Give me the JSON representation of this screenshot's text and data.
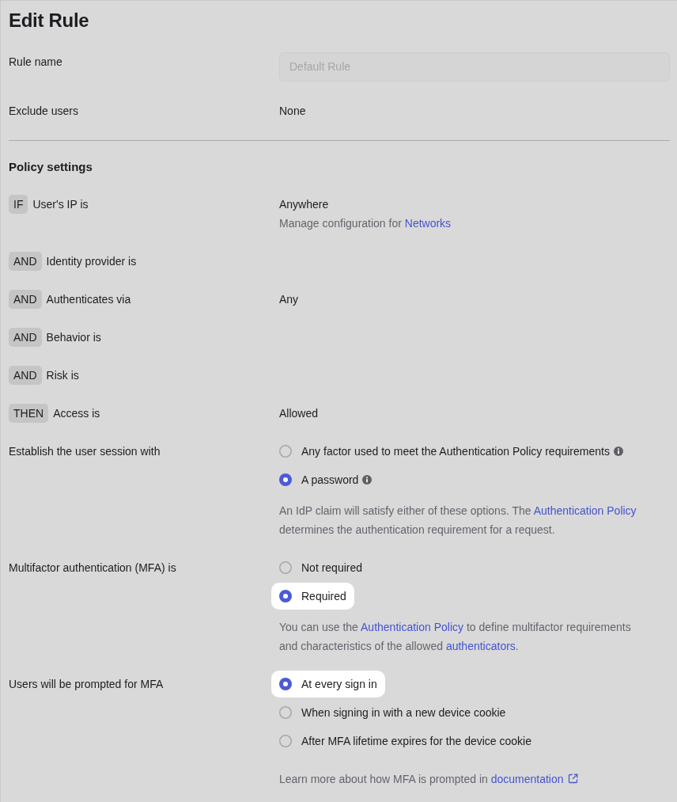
{
  "title": "Edit Rule",
  "fields": [
    {
      "label": "Rule name",
      "kind": "input",
      "value": "Default Rule",
      "disabled": true
    },
    {
      "label": "Exclude users",
      "kind": "text",
      "value": "None"
    }
  ],
  "policy": {
    "heading": "Policy settings",
    "conditions": [
      {
        "keyword": "IF",
        "label": "User's IP is",
        "value": "Anywhere",
        "note": [
          {
            "text": "Manage configuration for ",
            "link": false
          },
          {
            "text": "Networks",
            "link": true
          }
        ]
      },
      {
        "keyword": "AND",
        "label": "Identity provider is"
      },
      {
        "keyword": "AND",
        "label": "Authenticates via",
        "value": "Any"
      },
      {
        "keyword": "AND",
        "label": "Behavior is"
      },
      {
        "keyword": "AND",
        "label": "Risk is"
      },
      {
        "keyword": "THEN",
        "label": "Access is",
        "value": "Allowed"
      }
    ],
    "option_groups": [
      {
        "label": "Establish the user session with",
        "options": [
          {
            "label": "Any factor used to meet the Authentication Policy requirements",
            "selected": false,
            "highlighted": false,
            "info": true
          },
          {
            "label": "A password",
            "selected": true,
            "highlighted": false,
            "info": true
          }
        ],
        "note": [
          {
            "text": "An IdP claim will satisfy either of these options. The ",
            "link": false
          },
          {
            "text": "Authentication Policy",
            "link": true
          },
          {
            "text": " determines the authentication requirement for a request.",
            "link": false
          }
        ]
      },
      {
        "label": "Multifactor authentication (MFA) is",
        "options": [
          {
            "label": "Not required",
            "selected": false,
            "highlighted": false,
            "info": false
          },
          {
            "label": "Required",
            "selected": true,
            "highlighted": true,
            "info": false
          }
        ],
        "note": [
          {
            "text": "You can use the ",
            "link": false
          },
          {
            "text": "Authentication Policy",
            "link": true
          },
          {
            "text": " to define multifactor requirements and characteristics of the allowed ",
            "link": false
          },
          {
            "text": "authenticators",
            "link": true
          },
          {
            "text": ".",
            "link": false
          }
        ]
      },
      {
        "label": "Users will be prompted for MFA",
        "options": [
          {
            "label": "At every sign in",
            "selected": true,
            "highlighted": true,
            "info": false
          },
          {
            "label": "When signing in with a new device cookie",
            "selected": false,
            "highlighted": false,
            "info": false
          },
          {
            "label": "After MFA lifetime expires for the device cookie",
            "selected": false,
            "highlighted": false,
            "info": false
          }
        ],
        "note": [
          {
            "text": "Learn more about how MFA is prompted in ",
            "link": false
          },
          {
            "text": "documentation",
            "link": true,
            "external": true
          }
        ]
      }
    ]
  }
}
